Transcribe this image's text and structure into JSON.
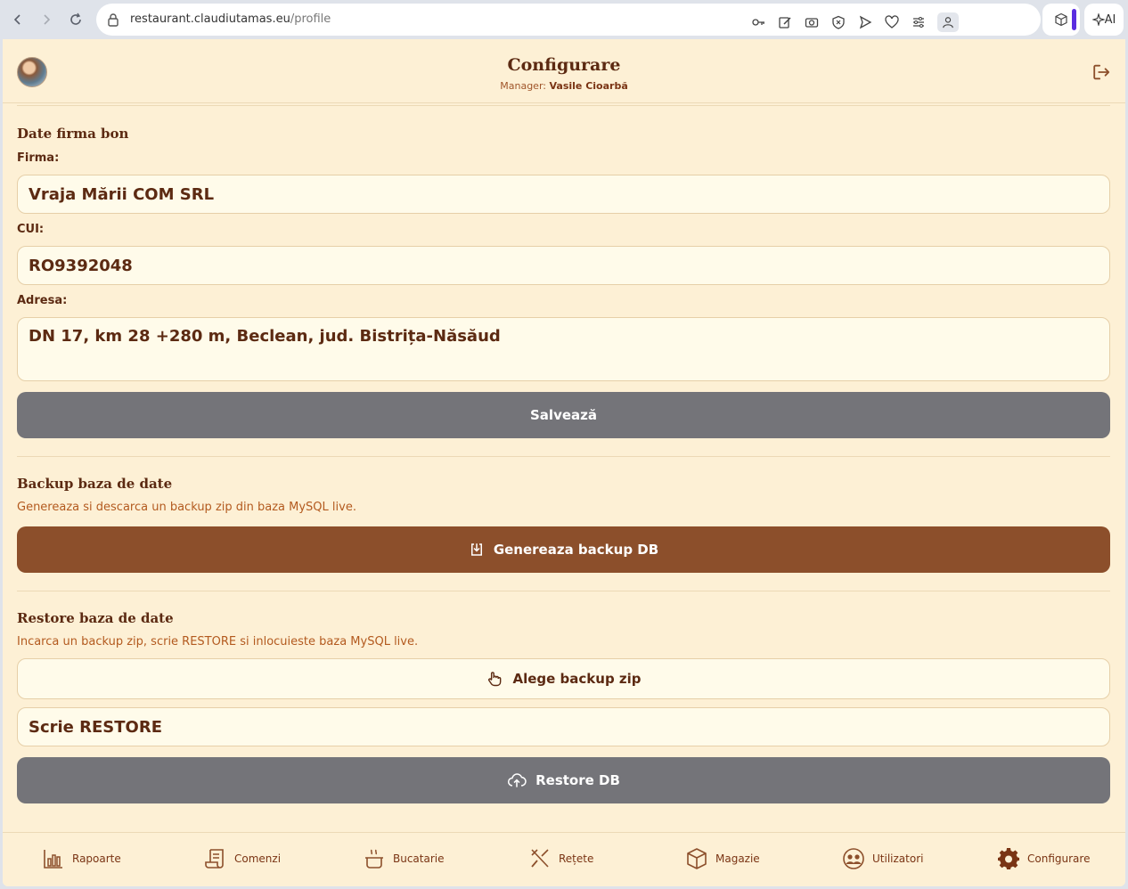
{
  "browser": {
    "url_host": "restaurant.claudiutamas.eu",
    "url_path": "/profile",
    "ai_label": "AI"
  },
  "header": {
    "title": "Configurare",
    "manager_label": "Manager:",
    "manager_name": "Vasile Cioarbă"
  },
  "company": {
    "section_title": "Date firma bon",
    "firma_label": "Firma:",
    "firma_value": "Vraja Mării COM SRL",
    "cui_label": "CUI:",
    "cui_value": "RO9392048",
    "adresa_label": "Adresa:",
    "adresa_value": "DN 17, km 28 +280 m, Beclean, jud. Bistrița-Năsăud",
    "save_label": "Salvează"
  },
  "backup": {
    "section_title": "Backup baza de date",
    "description": "Genereaza si descarca un backup zip din baza MySQL live.",
    "button_label": "Genereaza backup DB"
  },
  "restore": {
    "section_title": "Restore baza de date",
    "description": "Incarca un backup zip, scrie RESTORE si inlocuieste baza MySQL live.",
    "choose_label": "Alege backup zip",
    "confirm_value": "Scrie RESTORE",
    "button_label": "Restore DB"
  },
  "nav": {
    "items": [
      {
        "label": "Rapoarte",
        "icon": "bar-chart-icon"
      },
      {
        "label": "Comenzi",
        "icon": "receipt-icon"
      },
      {
        "label": "Bucatarie",
        "icon": "cooking-pot-icon"
      },
      {
        "label": "Rețete",
        "icon": "utensils-icon"
      },
      {
        "label": "Magazie",
        "icon": "box-icon"
      },
      {
        "label": "Utilizatori",
        "icon": "users-icon"
      },
      {
        "label": "Configurare",
        "icon": "gear-icon"
      }
    ]
  },
  "colors": {
    "background": "#fdf0d5",
    "text_dark": "#5c2a12",
    "accent_brown": "#8c4f2b",
    "button_grey": "#747479",
    "description_orange": "#b35a1f"
  }
}
